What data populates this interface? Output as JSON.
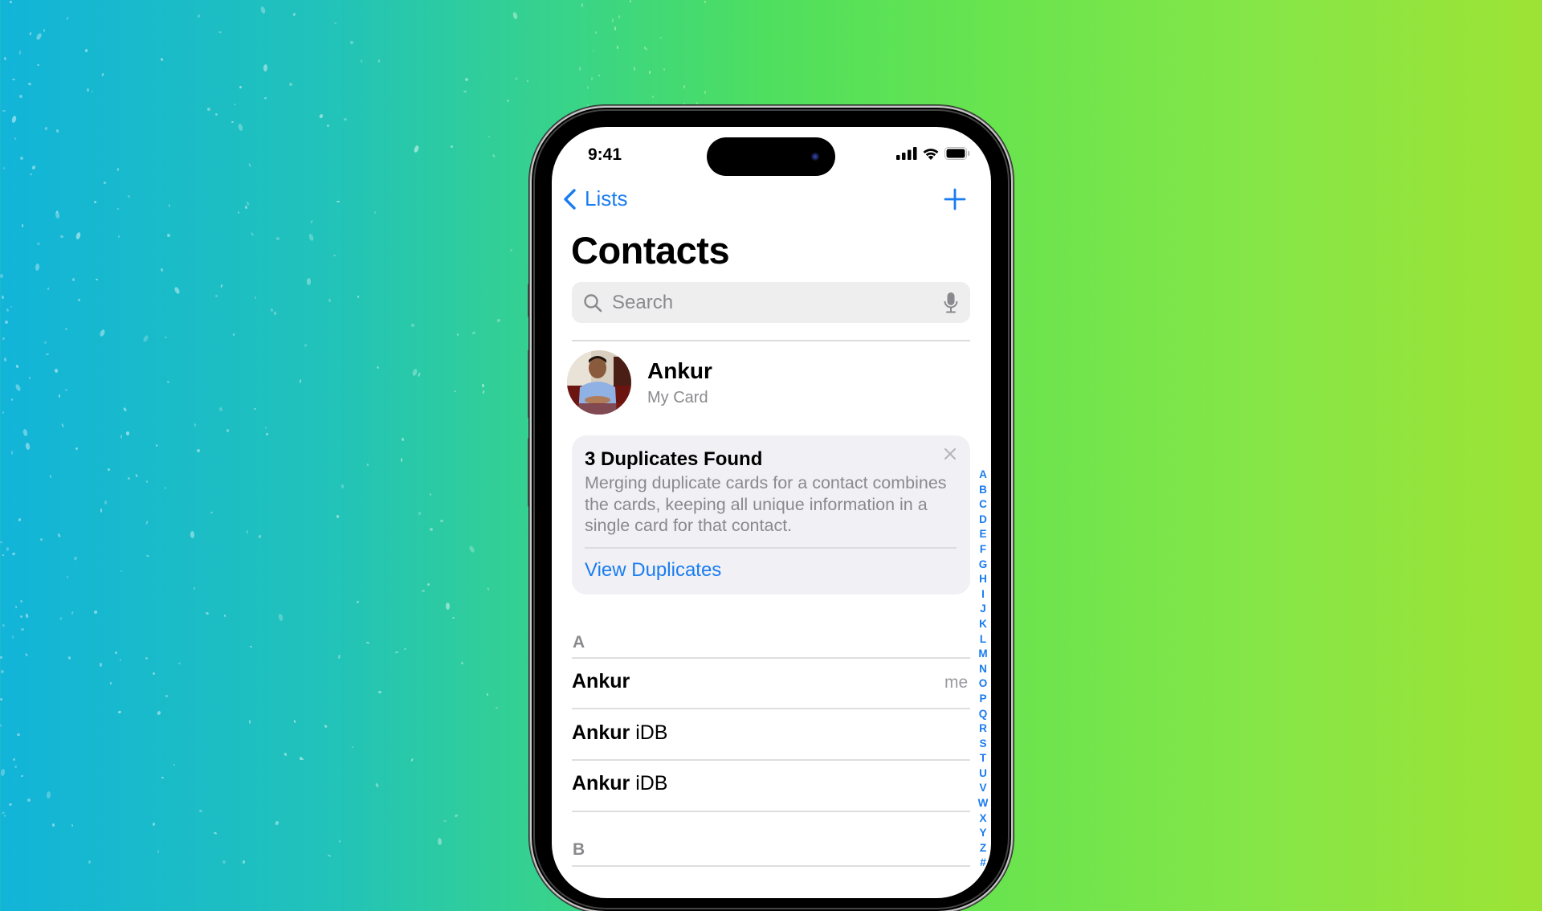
{
  "status_bar": {
    "time": "9:41",
    "icons": [
      "cellular-signal-icon",
      "wifi-icon",
      "battery-icon"
    ]
  },
  "nav": {
    "back_label": "Lists",
    "back_icon": "chevron-left-icon",
    "add_icon": "plus-icon"
  },
  "page_title": "Contacts",
  "search": {
    "placeholder": "Search",
    "value": "",
    "icon": "search-icon",
    "mic_icon": "microphone-icon"
  },
  "my_card": {
    "name": "Ankur",
    "subtitle": "My Card"
  },
  "duplicates_banner": {
    "title": "3 Duplicates Found",
    "body": "Merging duplicate cards for a contact combines the cards, keeping all unique information in a single card for that contact.",
    "action_label": "View Duplicates",
    "close_icon": "close-icon"
  },
  "sections": [
    {
      "letter": "A",
      "contacts": [
        {
          "first": "Ankur",
          "last": "",
          "tag": "me"
        },
        {
          "first": "Ankur",
          "last": "iDB",
          "tag": ""
        },
        {
          "first": "Ankur",
          "last": "iDB",
          "tag": ""
        }
      ]
    },
    {
      "letter": "B",
      "contacts": []
    }
  ],
  "index_letters": [
    "A",
    "B",
    "C",
    "D",
    "E",
    "F",
    "G",
    "H",
    "I",
    "J",
    "K",
    "L",
    "M",
    "N",
    "O",
    "P",
    "Q",
    "R",
    "S",
    "T",
    "U",
    "V",
    "W",
    "X",
    "Y",
    "Z",
    "#"
  ],
  "colors": {
    "accent": "#1a7cf0",
    "secondary_text": "#8a8a8e",
    "card_background": "#f1f1f5"
  }
}
